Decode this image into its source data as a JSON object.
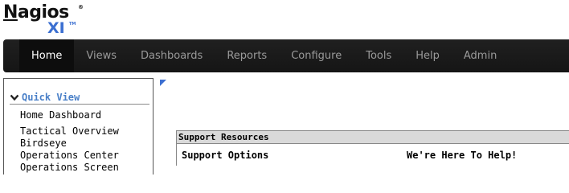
{
  "logo": {
    "name": "Nagios",
    "name_first": "N",
    "name_rest": "agios",
    "registered": "®",
    "edition": "XI",
    "trademark": "TM"
  },
  "nav": {
    "items": [
      {
        "label": "Home",
        "active": true
      },
      {
        "label": "Views"
      },
      {
        "label": "Dashboards"
      },
      {
        "label": "Reports"
      },
      {
        "label": "Configure"
      },
      {
        "label": "Tools"
      },
      {
        "label": "Help"
      },
      {
        "label": "Admin"
      }
    ]
  },
  "sidebar": {
    "section_title": "Quick View",
    "links": [
      "Home Dashboard",
      "Tactical Overview",
      "Birdseye",
      "Operations Center",
      "Operations Screen"
    ]
  },
  "support": {
    "header": "Support Resources",
    "left_title": "Support Options",
    "right_title": "We're Here To Help!"
  },
  "colors": {
    "accent": "#4a80c8",
    "nav_bg": "#1a1a1a",
    "nav_active_bg": "#0d0d0d",
    "panel_header_bg": "#d9d9d9"
  }
}
